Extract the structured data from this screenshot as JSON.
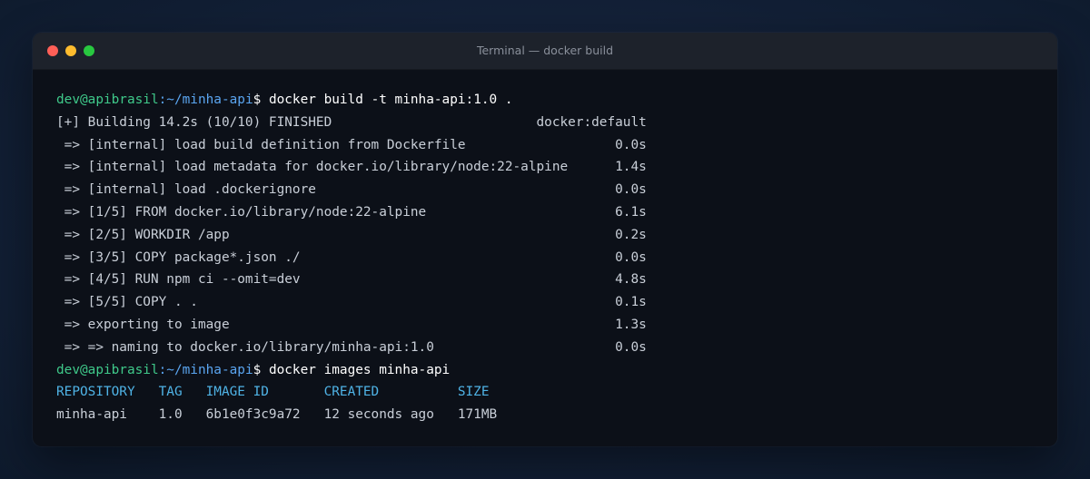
{
  "window": {
    "title": "Terminal — docker build",
    "colors": {
      "close": "#ff5f57",
      "minimize": "#febc2e",
      "maximize": "#28c840"
    }
  },
  "colors": {
    "prompt_user": "#3fc98a",
    "prompt_path": "#5aa5f0",
    "table_header": "#4fb3e6",
    "output_text": "#c9cfd8"
  },
  "terminal": {
    "prompt1": {
      "user_host": "dev@apibrasil",
      "path": ":~/minha-api",
      "symbol": "$ ",
      "command": "docker build -t minha-api:1.0 ."
    },
    "build_output": [
      "[+] Building 14.2s (10/10) FINISHED                          docker:default",
      " => [internal] load build definition from Dockerfile                   0.0s",
      " => [internal] load metadata for docker.io/library/node:22-alpine      1.4s",
      " => [internal] load .dockerignore                                      0.0s",
      " => [1/5] FROM docker.io/library/node:22-alpine                        6.1s",
      " => [2/5] WORKDIR /app                                                 0.2s",
      " => [3/5] COPY package*.json ./                                        0.0s",
      " => [4/5] RUN npm ci --omit=dev                                        4.8s",
      " => [5/5] COPY . .                                                     0.1s",
      " => exporting to image                                                 1.3s",
      " => => naming to docker.io/library/minha-api:1.0                       0.0s"
    ],
    "prompt2": {
      "user_host": "dev@apibrasil",
      "path": ":~/minha-api",
      "symbol": "$ ",
      "command": "docker images minha-api"
    },
    "images_header": "REPOSITORY   TAG   IMAGE ID       CREATED          SIZE",
    "images_row": "minha-api    1.0   6b1e0f3c9a72   12 seconds ago   171MB"
  }
}
